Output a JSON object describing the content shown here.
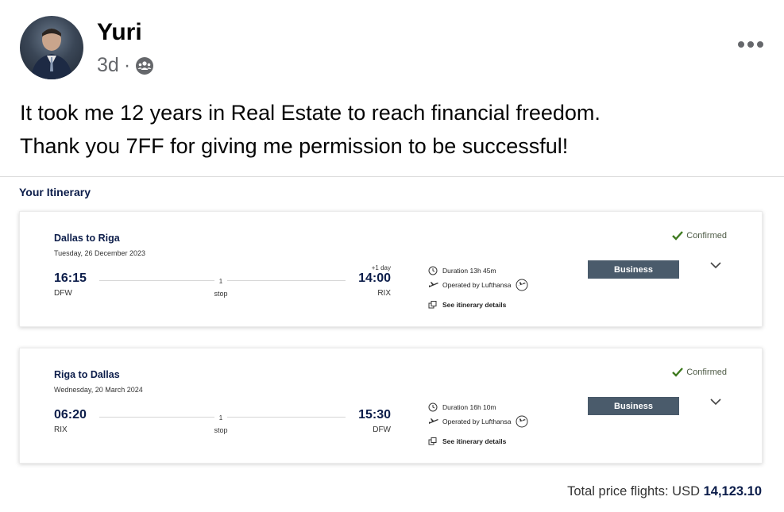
{
  "post": {
    "author": "Yuri",
    "time": "3d",
    "separator": "·",
    "audience_icon": "friends-icon",
    "text_lines": [
      "It took me 12 years in Real Estate to reach financial freedom.",
      "Thank you 7FF for giving me permission to be successful!"
    ]
  },
  "itinerary": {
    "title": "Your Itinerary",
    "flights": [
      {
        "route": "Dallas to Riga",
        "date": "Tuesday, 26 December 2023",
        "dep_time": "16:15",
        "dep_airport": "DFW",
        "arr_time": "14:00",
        "arr_airport": "RIX",
        "day_offset": "+1 day",
        "stops": "1",
        "stops_label": "stop",
        "duration": "Duration 13h 45m",
        "operated_by": "Operated by Lufthansa",
        "details_link": "See itinerary details",
        "status": "Confirmed",
        "cabin": "Business"
      },
      {
        "route": "Riga to Dallas",
        "date": "Wednesday, 20 March 2024",
        "dep_time": "06:20",
        "dep_airport": "RIX",
        "arr_time": "15:30",
        "arr_airport": "DFW",
        "day_offset": "",
        "stops": "1",
        "stops_label": "stop",
        "duration": "Duration 16h 10m",
        "operated_by": "Operated by Lufthansa",
        "details_link": "See itinerary details",
        "status": "Confirmed",
        "cabin": "Business"
      }
    ],
    "total_label": "Total price flights:",
    "total_currency": "USD",
    "total_amount": "14,123.10"
  },
  "colors": {
    "navy": "#0c1d4a",
    "cabin_badge": "#4a5b6b",
    "confirmed_green": "#3e7a1f",
    "meta_grey": "#65676b"
  }
}
